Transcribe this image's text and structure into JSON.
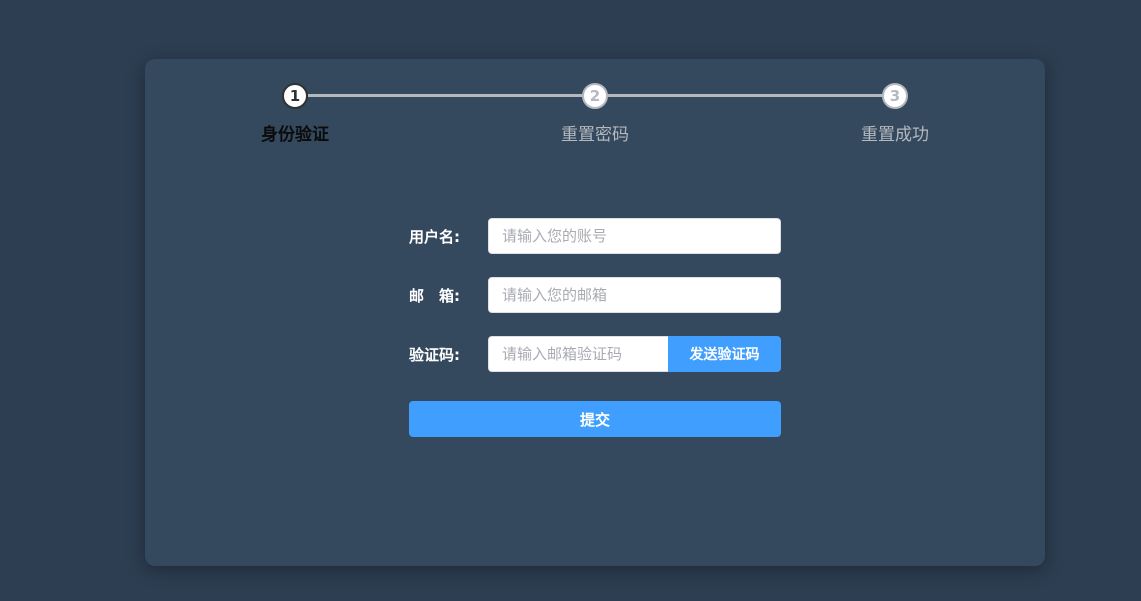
{
  "steps": [
    {
      "number": "1",
      "label": "身份验证",
      "active": true
    },
    {
      "number": "2",
      "label": "重置密码",
      "active": false
    },
    {
      "number": "3",
      "label": "重置成功",
      "active": false
    }
  ],
  "form": {
    "username": {
      "label": "用户名:",
      "placeholder": "请输入您的账号"
    },
    "email": {
      "label": "邮　箱:",
      "placeholder": "请输入您的邮箱"
    },
    "code": {
      "label": "验证码:",
      "placeholder": "请输入邮箱验证码",
      "send_label": "发送验证码"
    },
    "submit_label": "提交"
  },
  "colors": {
    "background": "#2d3e52",
    "card": "#34495e",
    "primary": "#409eff",
    "step_inactive": "#b4b8bf"
  }
}
